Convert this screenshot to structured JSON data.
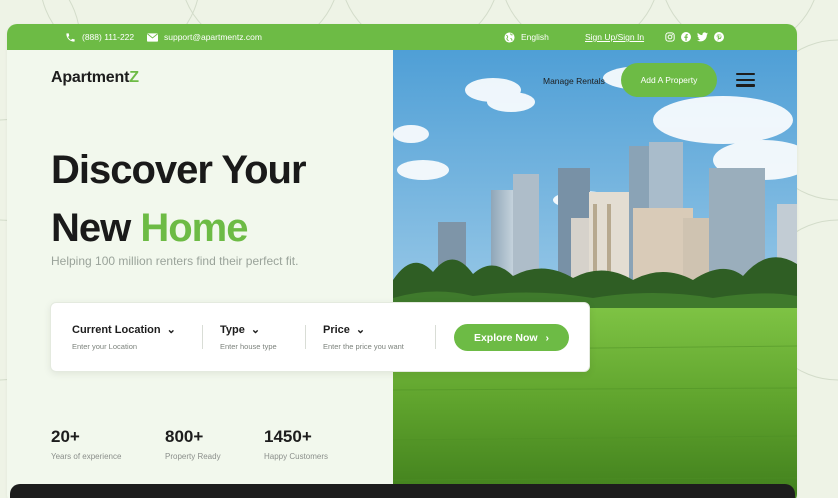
{
  "topbar": {
    "phone": "(888) 111-222",
    "email": "support@apartmentz.com",
    "language": "English",
    "signin": "Sign Up/Sign In",
    "socials": [
      "instagram-icon",
      "facebook-icon",
      "twitter-icon",
      "pinterest-icon"
    ]
  },
  "brand": {
    "name_main": "Apartment",
    "name_accent": "Z"
  },
  "nav": {
    "manage": "Manage Rentals",
    "add": "Add A Property"
  },
  "hero": {
    "line1": "Discover Your",
    "line2_dark": "New ",
    "line2_green": "Home",
    "subtitle": "Helping 100 million renters find their perfect fit."
  },
  "search": {
    "location": {
      "title": "Current Location",
      "hint": "Enter your Location"
    },
    "type": {
      "title": "Type",
      "hint": "Enter house type"
    },
    "price": {
      "title": "Price",
      "hint": "Enter the price you want"
    },
    "button": "Explore Now"
  },
  "stats": [
    {
      "value": "20+",
      "label": "Years of experience"
    },
    {
      "value": "800+",
      "label": "Property Ready"
    },
    {
      "value": "1450+",
      "label": "Happy Customers"
    }
  ],
  "colors": {
    "accent": "#6dbb45",
    "dark": "#1d1d1d",
    "bg": "#eef3e6"
  }
}
